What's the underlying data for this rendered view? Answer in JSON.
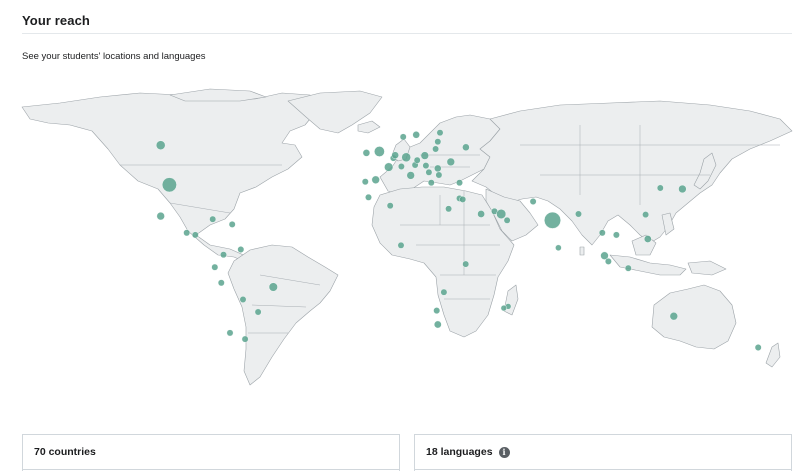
{
  "header": {
    "title": "Your reach"
  },
  "subtitle": "See your students' locations and languages",
  "map": {
    "land_color": "#eceeef",
    "border_color": "#9ca3a8",
    "bubble_color": "#5ba38e",
    "bubbles": [
      {
        "region": "Canada",
        "lon": -103,
        "lat": 57,
        "size": 2
      },
      {
        "region": "United States",
        "lon": -99,
        "lat": 38,
        "size": 5
      },
      {
        "region": "Mexico",
        "lon": -103,
        "lat": 23,
        "size": 1.5
      },
      {
        "region": "Guatemala",
        "lon": -91,
        "lat": 15,
        "size": 1
      },
      {
        "region": "Honduras",
        "lon": -87,
        "lat": 14,
        "size": 1
      },
      {
        "region": "Cuba",
        "lon": -79,
        "lat": 21.5,
        "size": 1
      },
      {
        "region": "Dominican Republic",
        "lon": -70,
        "lat": 19,
        "size": 1
      },
      {
        "region": "Colombia",
        "lon": -74,
        "lat": 4.5,
        "size": 1
      },
      {
        "region": "Venezuela",
        "lon": -66,
        "lat": 7,
        "size": 1
      },
      {
        "region": "Ecuador",
        "lon": -78,
        "lat": -1.5,
        "size": 1
      },
      {
        "region": "Peru",
        "lon": -75,
        "lat": -9,
        "size": 1
      },
      {
        "region": "Brazil",
        "lon": -51,
        "lat": -11,
        "size": 1.8
      },
      {
        "region": "Bolivia",
        "lon": -65,
        "lat": -17,
        "size": 1
      },
      {
        "region": "Paraguay",
        "lon": -58,
        "lat": -23,
        "size": 1
      },
      {
        "region": "Chile",
        "lon": -71,
        "lat": -33,
        "size": 1
      },
      {
        "region": "Argentina",
        "lon": -64,
        "lat": -36,
        "size": 1
      },
      {
        "region": "Ireland",
        "lon": -8,
        "lat": 53.3,
        "size": 1.2
      },
      {
        "region": "United Kingdom",
        "lon": -2,
        "lat": 54,
        "size": 2.5
      },
      {
        "region": "Portugal",
        "lon": -8.5,
        "lat": 39.5,
        "size": 1
      },
      {
        "region": "Spain",
        "lon": -3.7,
        "lat": 40.4,
        "size": 1.5
      },
      {
        "region": "France",
        "lon": 2.3,
        "lat": 46.5,
        "size": 1.8
      },
      {
        "region": "Belgium",
        "lon": 4.5,
        "lat": 50.8,
        "size": 1
      },
      {
        "region": "Netherlands",
        "lon": 5.3,
        "lat": 52.2,
        "size": 1.2
      },
      {
        "region": "Germany",
        "lon": 10.4,
        "lat": 51.2,
        "size": 2
      },
      {
        "region": "Switzerland",
        "lon": 8.2,
        "lat": 46.8,
        "size": 1
      },
      {
        "region": "Italy",
        "lon": 12.5,
        "lat": 42.5,
        "size": 1.5
      },
      {
        "region": "Austria",
        "lon": 14.5,
        "lat": 47.5,
        "size": 1
      },
      {
        "region": "Czechia",
        "lon": 15.5,
        "lat": 49.8,
        "size": 1
      },
      {
        "region": "Poland",
        "lon": 19,
        "lat": 52,
        "size": 1.5
      },
      {
        "region": "Norway",
        "lon": 9,
        "lat": 61,
        "size": 1
      },
      {
        "region": "Sweden",
        "lon": 15,
        "lat": 62,
        "size": 1.2
      },
      {
        "region": "Finland",
        "lon": 26,
        "lat": 63,
        "size": 1
      },
      {
        "region": "Estonia",
        "lon": 25,
        "lat": 58.7,
        "size": 1
      },
      {
        "region": "Lithuania",
        "lon": 24,
        "lat": 55.2,
        "size": 1
      },
      {
        "region": "Hungary",
        "lon": 19.5,
        "lat": 47.2,
        "size": 1
      },
      {
        "region": "Romania",
        "lon": 25,
        "lat": 45.9,
        "size": 1.2
      },
      {
        "region": "Serbia",
        "lon": 20.9,
        "lat": 44,
        "size": 1
      },
      {
        "region": "Greece",
        "lon": 22,
        "lat": 39,
        "size": 1
      },
      {
        "region": "Bulgaria",
        "lon": 25.5,
        "lat": 42.7,
        "size": 1
      },
      {
        "region": "Ukraine",
        "lon": 31,
        "lat": 49,
        "size": 1.5
      },
      {
        "region": "Russia",
        "lon": 38,
        "lat": 56,
        "size": 1.2
      },
      {
        "region": "Turkey",
        "lon": 35,
        "lat": 39,
        "size": 1
      },
      {
        "region": "Morocco",
        "lon": -7,
        "lat": 32,
        "size": 1
      },
      {
        "region": "Algeria",
        "lon": 3,
        "lat": 28,
        "size": 1
      },
      {
        "region": "Egypt",
        "lon": 30,
        "lat": 26.5,
        "size": 1
      },
      {
        "region": "Israel",
        "lon": 35,
        "lat": 31.5,
        "size": 1
      },
      {
        "region": "Jordan",
        "lon": 36.5,
        "lat": 31,
        "size": 1
      },
      {
        "region": "Saudi Arabia",
        "lon": 45,
        "lat": 24,
        "size": 1.3
      },
      {
        "region": "Qatar",
        "lon": 51.2,
        "lat": 25.3,
        "size": 1
      },
      {
        "region": "United Arab Emirates",
        "lon": 54.3,
        "lat": 24,
        "size": 2.2
      },
      {
        "region": "Oman",
        "lon": 57,
        "lat": 21,
        "size": 1
      },
      {
        "region": "Pakistan",
        "lon": 69,
        "lat": 30,
        "size": 1
      },
      {
        "region": "India",
        "lon": 78,
        "lat": 21,
        "size": 6.5
      },
      {
        "region": "Sri Lanka",
        "lon": 80.7,
        "lat": 7.8,
        "size": 0.9
      },
      {
        "region": "Nigeria",
        "lon": 8,
        "lat": 9,
        "size": 1
      },
      {
        "region": "Kenya",
        "lon": 37.9,
        "lat": 0,
        "size": 1
      },
      {
        "region": "Zambia",
        "lon": 27.8,
        "lat": -13.5,
        "size": 1
      },
      {
        "region": "South Africa",
        "lon": 25,
        "lat": -29,
        "size": 1.3
      },
      {
        "region": "Botswana",
        "lon": 24.5,
        "lat": -22.3,
        "size": 1
      },
      {
        "region": "Mauritius",
        "lon": 57.5,
        "lat": -20.3,
        "size": 0.8
      },
      {
        "region": "Reunion",
        "lon": 55.5,
        "lat": -21.1,
        "size": 0.8
      },
      {
        "region": "Bangladesh",
        "lon": 90,
        "lat": 24,
        "size": 1
      },
      {
        "region": "Thailand",
        "lon": 101,
        "lat": 15,
        "size": 1
      },
      {
        "region": "Vietnam",
        "lon": 107.5,
        "lat": 14,
        "size": 1
      },
      {
        "region": "Malaysia",
        "lon": 102,
        "lat": 4,
        "size": 1.5
      },
      {
        "region": "Singapore",
        "lon": 103.8,
        "lat": 1.3,
        "size": 1
      },
      {
        "region": "Indonesia",
        "lon": 113,
        "lat": -2,
        "size": 1
      },
      {
        "region": "Philippines",
        "lon": 122,
        "lat": 12,
        "size": 1.3
      },
      {
        "region": "Taiwan",
        "lon": 121,
        "lat": 23.7,
        "size": 1
      },
      {
        "region": "South Korea",
        "lon": 127.8,
        "lat": 36.5,
        "size": 1
      },
      {
        "region": "Japan",
        "lon": 138,
        "lat": 36,
        "size": 1.5
      },
      {
        "region": "Australia",
        "lon": 134,
        "lat": -25,
        "size": 1.5
      },
      {
        "region": "New Zealand",
        "lon": 173,
        "lat": -40,
        "size": 1
      }
    ]
  },
  "countries_card": {
    "title": "70 countries"
  },
  "languages_card": {
    "title": "18 languages",
    "info_glyph": "i"
  }
}
